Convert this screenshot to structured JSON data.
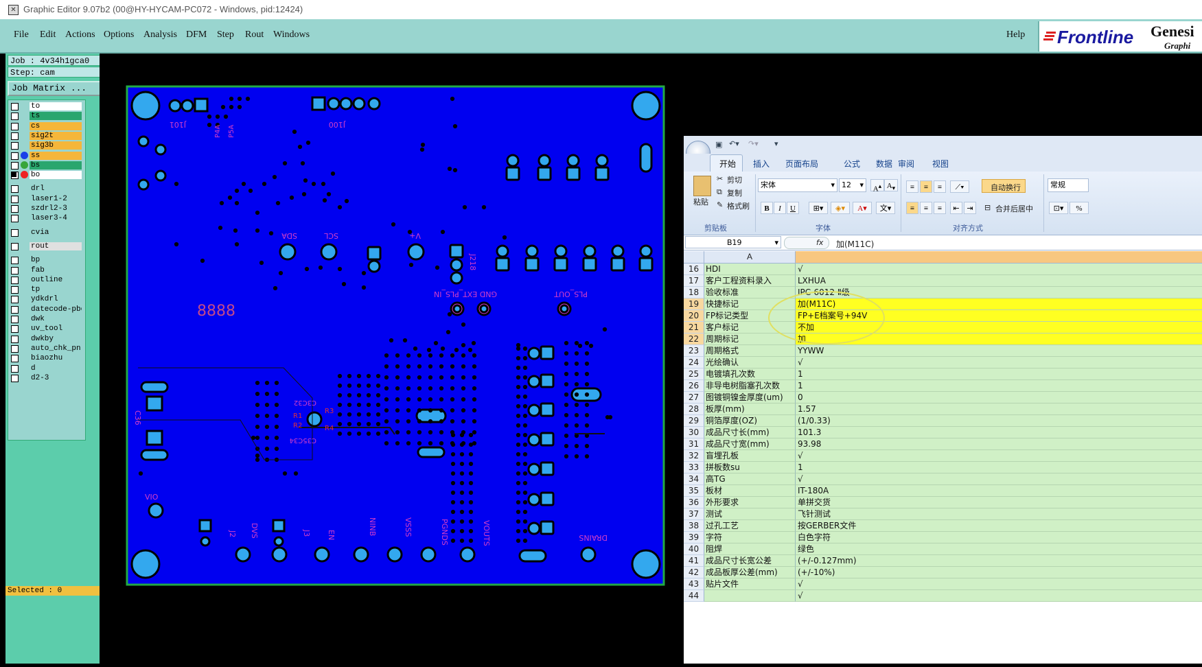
{
  "window": {
    "title": "Graphic Editor 9.07b2 (00@HY-HYCAM-PC072 - Windows, pid:12424)"
  },
  "menu": {
    "items": [
      "File",
      "Edit",
      "Actions",
      "Options",
      "Analysis",
      "DFM",
      "Step",
      "Rout",
      "Windows"
    ],
    "help": "Help"
  },
  "brand": {
    "logo": "Frontline",
    "product": "Genesi",
    "subtitle": "Graphi"
  },
  "left_panel": {
    "job": "Job : 4v34h1gca0",
    "step": "Step: cam",
    "job_matrix": "Job Matrix ...",
    "selected": "Selected : 0",
    "layers": [
      {
        "name": "to",
        "color": "#ffffff"
      },
      {
        "name": "ts",
        "color": "#2aa66e"
      },
      {
        "name": "cs",
        "color": "#f5b63a"
      },
      {
        "name": "sig2t",
        "color": "#f5b63a"
      },
      {
        "name": "sig3b",
        "color": "#f5b63a"
      },
      {
        "name": "ss",
        "color": "#f5b63a"
      },
      {
        "name": "bs",
        "color": "#2aa66e"
      },
      {
        "name": "bo",
        "color": "#ffffff"
      },
      {
        "name": "drl",
        "color": "#99d5cf"
      },
      {
        "name": "laser1-2",
        "color": "#99d5cf"
      },
      {
        "name": "szdrl2-3",
        "color": "#99d5cf"
      },
      {
        "name": "laser3-4",
        "color": "#99d5cf"
      },
      {
        "name": "cvia",
        "color": "#99d5cf"
      },
      {
        "name": "rout",
        "color": "#e0e0e0"
      },
      {
        "name": "bp",
        "color": "#99d5cf"
      },
      {
        "name": "fab",
        "color": "#99d5cf"
      },
      {
        "name": "outline",
        "color": "#99d5cf"
      },
      {
        "name": "tp",
        "color": "#99d5cf"
      },
      {
        "name": "ydkdrl",
        "color": "#99d5cf"
      },
      {
        "name": "datecode-pbe",
        "color": "#99d5cf"
      },
      {
        "name": "dwk",
        "color": "#99d5cf"
      },
      {
        "name": "uv_tool",
        "color": "#99d5cf"
      },
      {
        "name": "dwkby",
        "color": "#99d5cf"
      },
      {
        "name": "auto_chk_pn.",
        "color": "#99d5cf"
      },
      {
        "name": "biaozhu",
        "color": "#99d5cf"
      },
      {
        "name": "d",
        "color": "#99d5cf"
      },
      {
        "name": "d2-3",
        "color": "#99d5cf"
      }
    ]
  },
  "pcb": {
    "labels": {
      "j101": "J101",
      "j100": "J100",
      "sda": "SDA",
      "scl": "SCL",
      "vplus": "V+",
      "j218": "J218",
      "gnd_ext": "GND EXT_PLS_IN",
      "pls_out": "PLS_OUT",
      "num8888": "8888",
      "c36": "C36",
      "c3c2": "C3C32",
      "r1": "R1",
      "r2": "R2",
      "r3": "R3",
      "r4": "R4",
      "c35": "C35C34",
      "vio": "VIO",
      "dvs": "DVS",
      "j2": "J2",
      "j3": "J3",
      "en": "EN",
      "ninb": "NINB",
      "vsss": "VSSS",
      "pgnds": "PGNDS",
      "vouts": "VOUTS",
      "drains": "DRAINS",
      "p4a": "P4A",
      "p5a": "P5A"
    }
  },
  "excel": {
    "tabs": [
      "开始",
      "插入",
      "页面布局",
      "公式",
      "数据",
      "审阅",
      "视图"
    ],
    "clipboard": {
      "paste": "粘贴",
      "cut": "剪切",
      "copy": "复制",
      "format_painter": "格式刷",
      "group": "剪贴板"
    },
    "font": {
      "name": "宋体",
      "size": "12",
      "group": "字体"
    },
    "alignment": {
      "wrap": "自动换行",
      "merge": "合并后居中",
      "group": "对齐方式"
    },
    "number": {
      "format": "常规"
    },
    "name_box": "B19",
    "formula": "加(M11C)",
    "col_a": "A",
    "rows": [
      {
        "n": "16",
        "a": "HDI",
        "b": "√",
        "hl": false
      },
      {
        "n": "17",
        "a": "客户工程资料录入",
        "b": "LXHUA",
        "hl": false
      },
      {
        "n": "18",
        "a": "验收标准",
        "b": "IPC-6012 Ⅱ级",
        "hl": false
      },
      {
        "n": "19",
        "a": "快捷标记",
        "b": "加(M11C)",
        "hl": true
      },
      {
        "n": "20",
        "a": "FP标记类型",
        "b": "FP+E档案号+94V",
        "hl": true
      },
      {
        "n": "21",
        "a": "客户标记",
        "b": "不加",
        "hl": true
      },
      {
        "n": "22",
        "a": "周期标记",
        "b": "加",
        "hl": true
      },
      {
        "n": "23",
        "a": "周期格式",
        "b": "YYWW",
        "hl": false
      },
      {
        "n": "24",
        "a": "光绘确认",
        "b": "√",
        "hl": false
      },
      {
        "n": "25",
        "a": "电镀填孔次数",
        "b": "1",
        "hl": false
      },
      {
        "n": "26",
        "a": "非导电树脂塞孔次数",
        "b": "1",
        "hl": false
      },
      {
        "n": "27",
        "a": "图镀铜镍金厚度(um)",
        "b": "0",
        "hl": false
      },
      {
        "n": "28",
        "a": "板厚(mm)",
        "b": "1.57",
        "hl": false
      },
      {
        "n": "29",
        "a": "铜箔厚度(OZ)",
        "b": "(1/0.33)",
        "hl": false
      },
      {
        "n": "30",
        "a": "成品尺寸长(mm)",
        "b": "101.3",
        "hl": false
      },
      {
        "n": "31",
        "a": "成品尺寸宽(mm)",
        "b": "93.98",
        "hl": false
      },
      {
        "n": "32",
        "a": "盲埋孔板",
        "b": "√",
        "hl": false
      },
      {
        "n": "33",
        "a": "拼板数su",
        "b": "1",
        "hl": false
      },
      {
        "n": "34",
        "a": "高TG",
        "b": "√",
        "hl": false
      },
      {
        "n": "35",
        "a": "板材",
        "b": "IT-180A",
        "hl": false
      },
      {
        "n": "36",
        "a": "外形要求",
        "b": "单拼交货",
        "hl": false
      },
      {
        "n": "37",
        "a": "测试",
        "b": "飞针测试",
        "hl": false
      },
      {
        "n": "38",
        "a": "过孔工艺",
        "b": "按GERBER文件",
        "hl": false
      },
      {
        "n": "39",
        "a": "字符",
        "b": "白色字符",
        "hl": false
      },
      {
        "n": "40",
        "a": "阻焊",
        "b": "绿色",
        "hl": false
      },
      {
        "n": "41",
        "a": "成品尺寸长宽公差",
        "b": "(+/-0.127mm)",
        "hl": false
      },
      {
        "n": "42",
        "a": "成品板厚公差(mm)",
        "b": "(+/-10%)",
        "hl": false
      },
      {
        "n": "43",
        "a": "贴片文件",
        "b": "√",
        "hl": false
      },
      {
        "n": "44",
        "a": "",
        "b": "√",
        "hl": false
      }
    ]
  },
  "colors": {
    "board": "#0000f0",
    "pad": "#33a8ee",
    "silk": "#d33ec8",
    "panel": "#5ccdab",
    "menubar": "#99d5cf",
    "highlight": "#ffff22"
  }
}
